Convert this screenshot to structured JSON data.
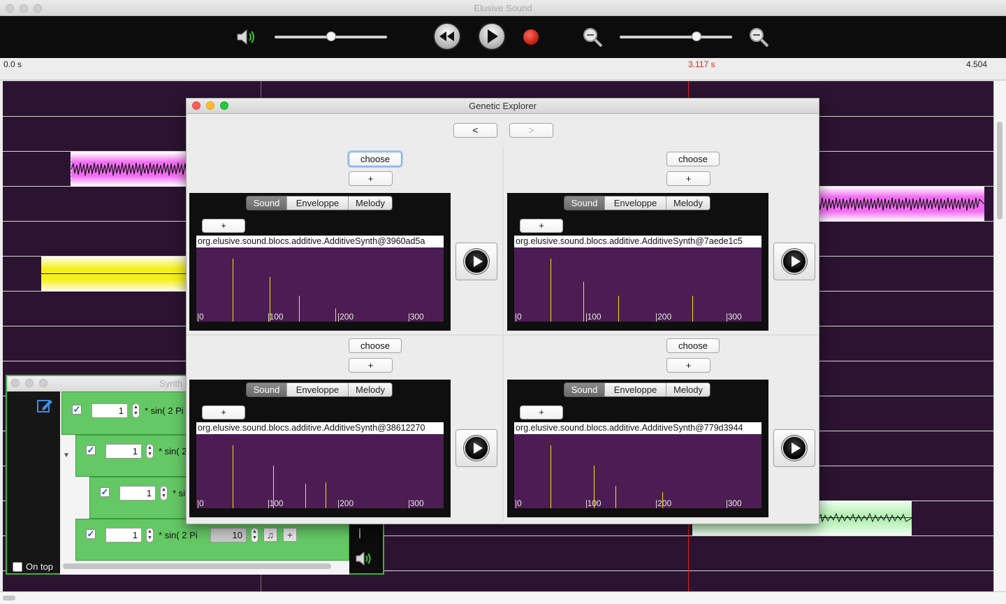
{
  "window": {
    "title": "Elusive Sound"
  },
  "ruler": {
    "start": "0.0 s",
    "cursor": "3.117 s",
    "end": "4.504"
  },
  "colors": {
    "timeline_bg": "#2c1331",
    "cursor": "#e0201a",
    "pink_clip": "#f26bf2",
    "yellow_clip": "#f4f01a",
    "green_clip": "#b7f0b7",
    "synth_row": "#64c864",
    "spectrum_bg": "#4c1d52",
    "spectrum_bar": "#f2e21a"
  },
  "toolbar": {
    "volume_icon": "speaker-icon",
    "volume_level": 0.5,
    "rewind_icon": "rewind-icon",
    "play_icon": "play-icon",
    "record_icon": "record-icon",
    "zoom_out_icon": "zoom-out-icon",
    "zoom_level": 0.7,
    "zoom_in_icon": "zoom-in-icon"
  },
  "synth": {
    "title": "Synth",
    "on_top_label": "On top",
    "rows": [
      {
        "value": "1",
        "expr": "* sin( 2 Pi"
      },
      {
        "value": "1",
        "expr": "* sin( 2"
      },
      {
        "value": "1",
        "expr": "* si"
      },
      {
        "value": "1",
        "expr": "* sin( 2 Pi",
        "extra_value": "10"
      }
    ],
    "add_label": "+"
  },
  "explorer": {
    "title": "Genetic Explorer",
    "prev_label": "<",
    "next_label": ">",
    "choose_label": "choose",
    "plus_label": "+",
    "tabs": [
      "Sound",
      "Enveloppe",
      "Melody"
    ],
    "spectrum_ticks": [
      "0",
      "100",
      "200",
      "300"
    ],
    "cells": [
      {
        "name": "org.elusive.sound.blocs.additive.AdditiveSynth@3960ad5a",
        "peaks": [
          [
            50,
            0.85
          ],
          [
            102,
            0.6
          ],
          [
            144,
            0.35
          ],
          [
            196,
            0.18
          ]
        ]
      },
      {
        "name": "org.elusive.sound.blocs.additive.AdditiveSynth@7aede1c5",
        "peaks": [
          [
            50,
            0.85
          ],
          [
            96,
            0.54
          ],
          [
            146,
            0.35
          ],
          [
            252,
            0.35
          ]
        ]
      },
      {
        "name": "org.elusive.sound.blocs.additive.AdditiveSynth@38612270",
        "peaks": [
          [
            50,
            0.85
          ],
          [
            107,
            0.58
          ],
          [
            153,
            0.33
          ],
          [
            182,
            0.35
          ]
        ]
      },
      {
        "name": "org.elusive.sound.blocs.additive.AdditiveSynth@779d3944",
        "peaks": [
          [
            50,
            0.85
          ],
          [
            111,
            0.58
          ],
          [
            142,
            0.3
          ],
          [
            209,
            0.22
          ]
        ]
      }
    ]
  }
}
